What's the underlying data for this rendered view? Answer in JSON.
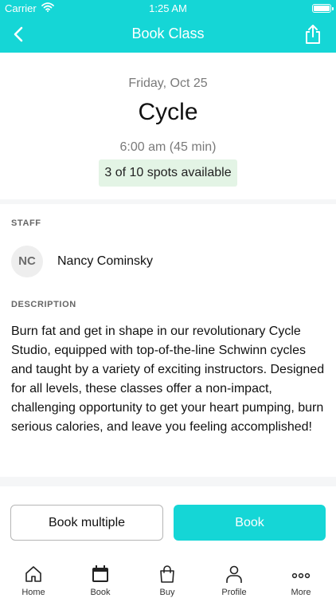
{
  "status_bar": {
    "carrier": "Carrier",
    "time": "1:25 AM"
  },
  "nav": {
    "title": "Book Class"
  },
  "class_info": {
    "date": "Friday, Oct 25",
    "name": "Cycle",
    "time": "6:00 am (45 min)",
    "spots": "3 of 10 spots available"
  },
  "staff": {
    "label": "STAFF",
    "initials": "NC",
    "name": "Nancy Cominsky"
  },
  "description": {
    "label": "DESCRIPTION",
    "text": "Burn fat and get in shape in our revolutionary Cycle Studio, equipped with top-of-the-line Schwinn cycles and taught by a variety of exciting instructors. Designed for all levels, these classes offer a non-impact, challenging opportunity to get your heart pumping, burn serious calories, and leave you feeling accomplished!"
  },
  "actions": {
    "book_multiple": "Book multiple",
    "book": "Book"
  },
  "tabs": [
    {
      "label": "Home",
      "icon": "home-icon"
    },
    {
      "label": "Book",
      "icon": "calendar-icon"
    },
    {
      "label": "Buy",
      "icon": "shopping-bag-icon"
    },
    {
      "label": "Profile",
      "icon": "profile-icon"
    },
    {
      "label": "More",
      "icon": "more-icon"
    }
  ],
  "colors": {
    "accent": "#15d6d6",
    "spots_badge": "#e3f4e5"
  }
}
